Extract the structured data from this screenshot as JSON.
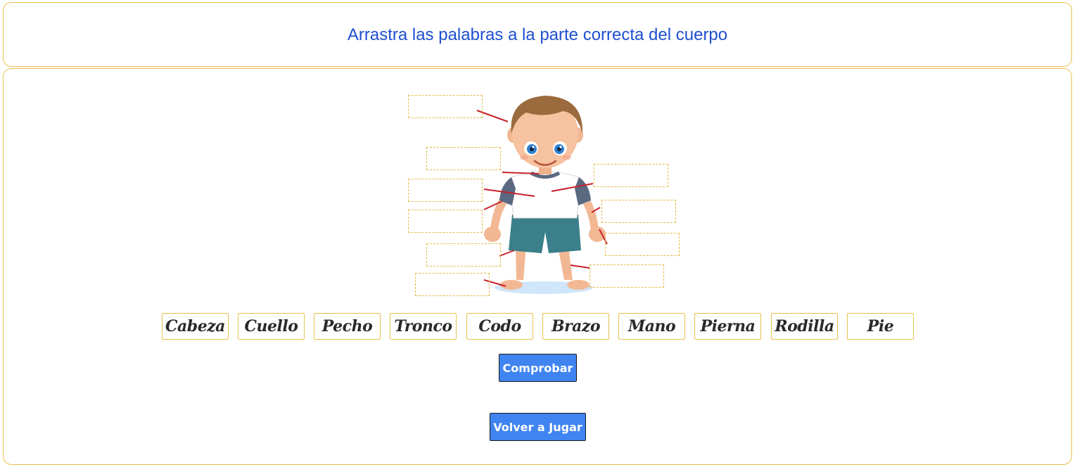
{
  "header": {
    "title": "Arrastra las palabras a la parte correcta del cuerpo"
  },
  "figure": {
    "illustration": "cartoon-child-body-parts",
    "drop_targets": [
      "",
      "",
      "",
      "",
      "",
      "",
      "",
      "",
      "",
      ""
    ]
  },
  "words": [
    "Cabeza",
    "Cuello",
    "Pecho",
    "Tronco",
    "Codo",
    "Brazo",
    "Mano",
    "Pierna",
    "Rodilla",
    "Pie"
  ],
  "buttons": {
    "check_label": "Comprobar",
    "replay_label": "Volver a Jugar"
  },
  "colors": {
    "title": "#1f4fd1",
    "panel_border": "#e7c24c",
    "button_bg": "#3f84f0",
    "pointer_line": "#c8232c"
  }
}
